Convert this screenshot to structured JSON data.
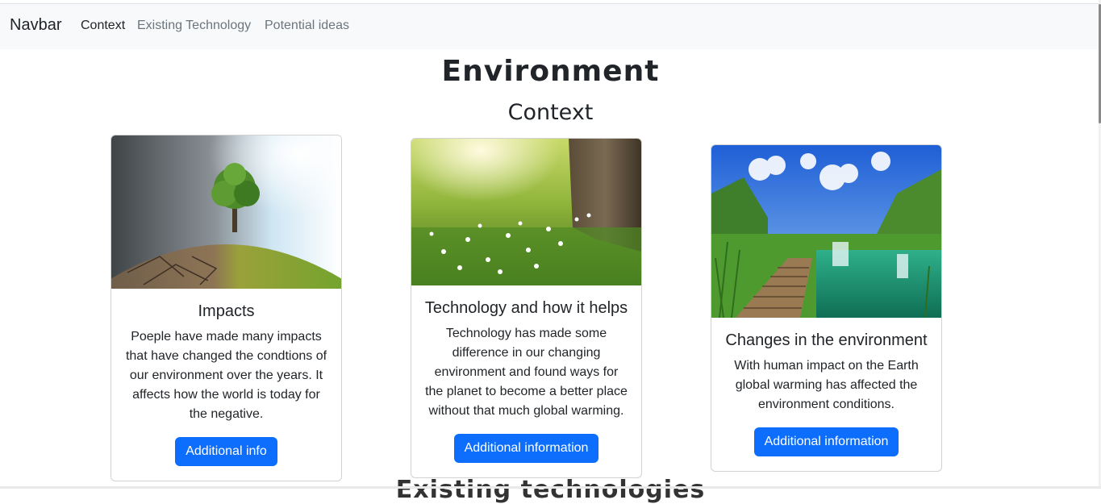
{
  "navbar": {
    "brand": "Navbar",
    "links": [
      {
        "label": "Context",
        "active": true
      },
      {
        "label": "Existing Technology",
        "active": false
      },
      {
        "label": "Potential ideas",
        "active": false
      }
    ]
  },
  "page": {
    "title": "Environment",
    "section_title": "Context",
    "next_section_title": "Existing technologies"
  },
  "cards": [
    {
      "title": "Impacts",
      "text": "Poeple have made many impacts that have changed the condtions of our environment over the years. It affects how the world is today for the negative.",
      "button_label": "Additional info"
    },
    {
      "title": "Technology and how it helps",
      "text": "Technology has made some difference in our changing environment and found ways for the planet to become a better place without that much global warming.",
      "button_label": "Additional information"
    },
    {
      "title": "Changes in the environment",
      "text": "With human impact on the Earth global warming has affected the environment conditions.",
      "button_label": "Additional information"
    }
  ],
  "colors": {
    "primary": "#0d6efd",
    "navbar_bg": "#f8f9fa",
    "muted_link": "#6c757d"
  }
}
